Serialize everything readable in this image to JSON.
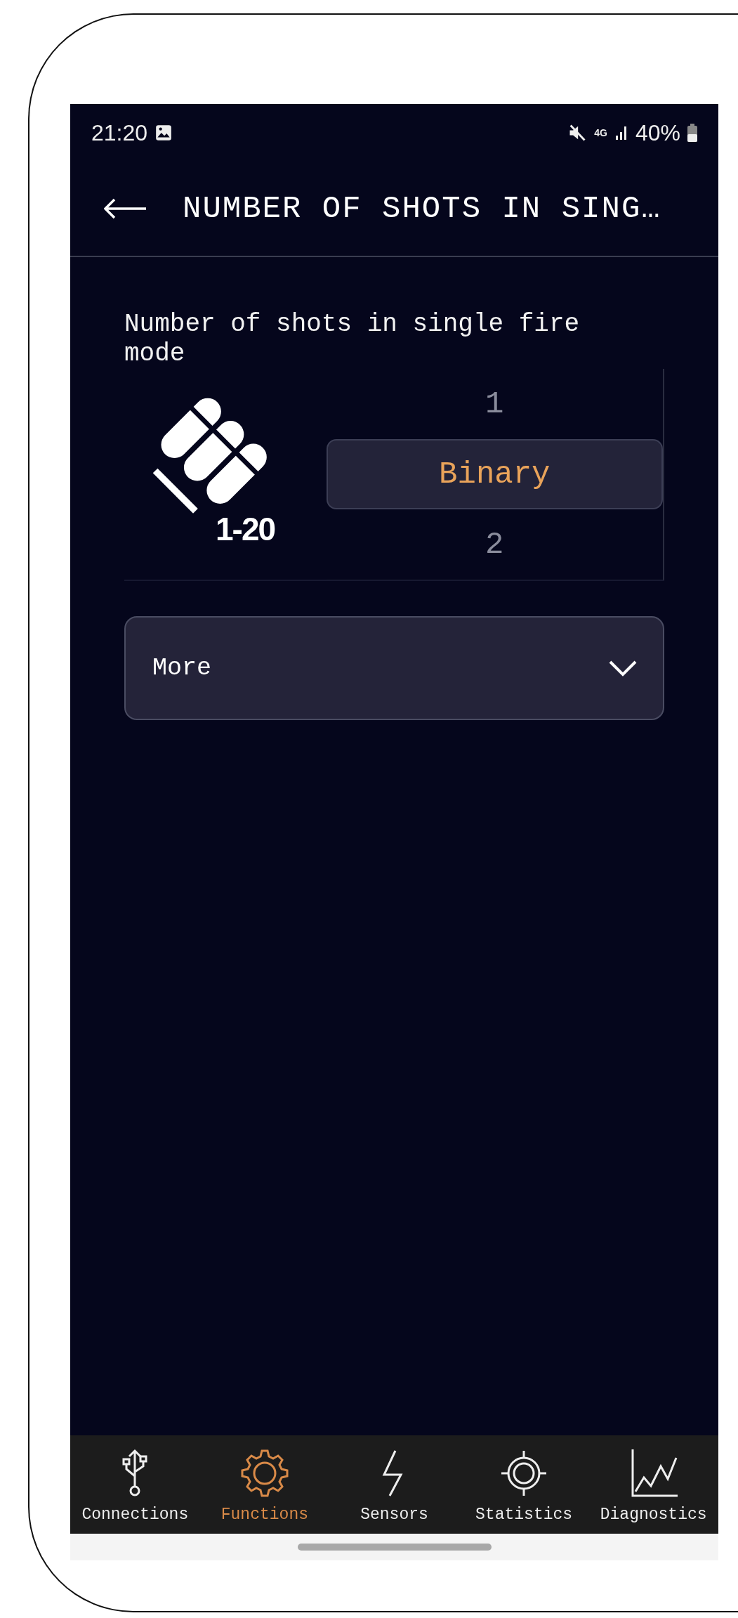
{
  "status_bar": {
    "time": "21:20",
    "network": "4G",
    "battery": "40%"
  },
  "header": {
    "title": "NUMBER OF SHOTS IN SING…"
  },
  "setting": {
    "label": "Number of shots in single fire mode",
    "icon_caption": "1-20",
    "picker": [
      {
        "label": "1",
        "selected": false
      },
      {
        "label": "Binary",
        "selected": true
      },
      {
        "label": "2",
        "selected": false
      }
    ]
  },
  "more": {
    "label": "More",
    "expanded": false
  },
  "nav": [
    {
      "label": "Connections",
      "selected": false
    },
    {
      "label": "Functions",
      "selected": true
    },
    {
      "label": "Sensors",
      "selected": false
    },
    {
      "label": "Statistics",
      "selected": false
    },
    {
      "label": "Diagnostics",
      "selected": false
    }
  ]
}
